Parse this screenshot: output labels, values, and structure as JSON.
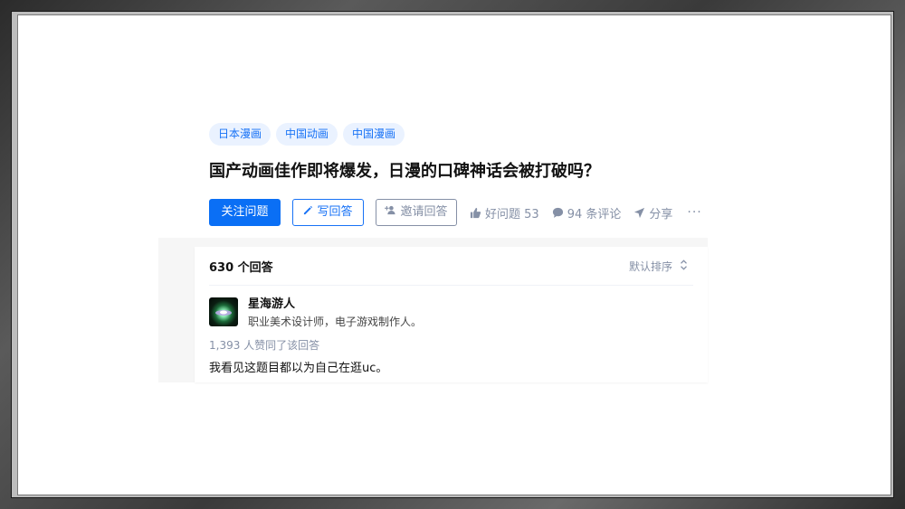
{
  "tags": [
    "日本漫画",
    "中国动画",
    "中国漫画"
  ],
  "question": {
    "title": "国产动画佳作即将爆发，日漫的口碑神话会被打破吗？"
  },
  "actions": {
    "follow_label": "关注问题",
    "write_label": "写回答",
    "invite_label": "邀请回答",
    "good_question_label": "好问题 53",
    "comments_label": "94 条评论",
    "share_label": "分享",
    "more_label": "···"
  },
  "answers": {
    "count_label": "630 个回答",
    "sort_label": "默认排序"
  },
  "answer": {
    "author_name": "星海游人",
    "author_desc": "职业美术设计师，电子游戏制作人。",
    "votes_label": "1,393 人赞同了该回答",
    "content": "我看见这题目都以为自己在逛uc。"
  },
  "colors": {
    "accent": "#0a6ff5",
    "tag_bg": "#eaf2ff",
    "muted": "#8590a6"
  }
}
